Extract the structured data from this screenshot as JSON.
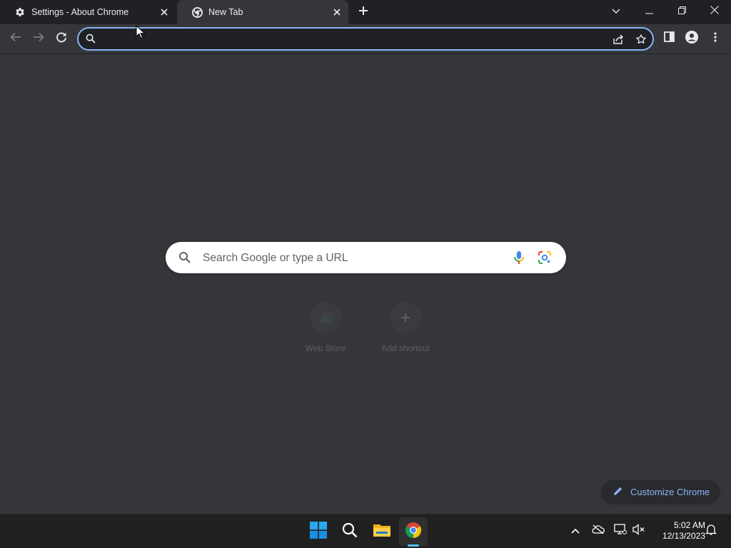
{
  "tabs": [
    {
      "title": "Settings - About Chrome",
      "icon": "gear-icon"
    },
    {
      "title": "New Tab",
      "icon": "chrome-icon",
      "active": true
    }
  ],
  "toolbar": {
    "omnibox_value": "",
    "icons": [
      "back-arrow-icon",
      "forward-arrow-icon",
      "reload-icon",
      "search-icon",
      "share-icon",
      "star-icon",
      "side-panel-icon",
      "profile-icon",
      "more-vert-icon"
    ]
  },
  "ntp": {
    "search_placeholder": "Search Google or type a URL",
    "shortcuts": [
      {
        "label": "Web Store"
      },
      {
        "label": "Add shortcut"
      }
    ],
    "customize_label": "Customize Chrome"
  },
  "taskbar": {
    "time": "5:02 AM",
    "date": "12/13/2023",
    "apps": [
      "windows-start-icon",
      "search-icon",
      "file-explorer-icon",
      "chrome-icon"
    ]
  },
  "colors": {
    "tabstrip_bg": "#202124",
    "toolbar_bg": "#35363a",
    "accent": "#8ab4f8",
    "taskbar_bg": "#202020",
    "taskbar_accent": "#4cc2ff"
  }
}
